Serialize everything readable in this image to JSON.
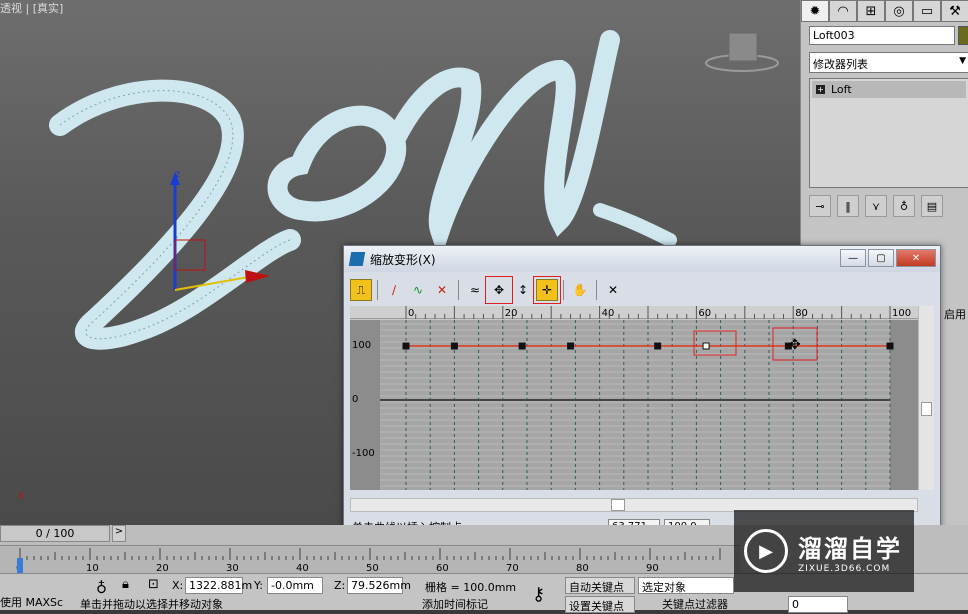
{
  "viewport": {
    "label": "透视 | [真实]",
    "axes": {
      "z": "z",
      "x": "x"
    }
  },
  "command_panel": {
    "tab_icons": [
      "create-icon",
      "modify-icon",
      "hierarchy-icon",
      "motion-icon",
      "display-icon",
      "utilities-icon"
    ],
    "object_name": "Loft003",
    "modifier_list": "修改器列表",
    "stack_item": "Loft",
    "side_text": "启用",
    "object_color": "#6b6b1e"
  },
  "dialog": {
    "title": "缩放变形(X)",
    "win_buttons": {
      "minimize": "—",
      "maximize": "▢",
      "close": "✕"
    },
    "toolbar_icons": [
      "make-symmetrical-icon",
      "display-x-icon",
      "display-y-icon",
      "display-xy-icon",
      "swap-curves-icon",
      "move-control-point-icon",
      "scale-control-point-icon",
      "insert-corner-point-icon",
      "delete-control-point-icon",
      "reset-curve-icon"
    ],
    "ruler_ticks": [
      "0",
      "20",
      "40",
      "60",
      "80",
      "100"
    ],
    "y_labels": [
      "100",
      "0",
      "-100"
    ],
    "curve": {
      "value": 100,
      "control_points_x": [
        0,
        10,
        24,
        34,
        52,
        62,
        79,
        100
      ]
    },
    "status_message": "单击曲线以插入控制点。",
    "coord_x": "63.771",
    "coord_y": "100.0",
    "curve_color": "#e03a1e"
  },
  "timeline": {
    "frame_display": "0 / 100",
    "next_arrow": ">",
    "ticks": [
      "0",
      "10",
      "20",
      "30",
      "40",
      "50",
      "60",
      "70",
      "80",
      "90"
    ]
  },
  "bottom": {
    "x_label": "X:",
    "x_value": "1322.881m",
    "y_label": "Y:",
    "y_value": "-0.0mm",
    "z_label": "Z:",
    "z_value": "79.526mm",
    "grid": "栅格 = 100.0mm",
    "auto_key": "自动关键点",
    "selected": "选定对象",
    "set_key": "设置关键点",
    "key_filter": "关键点过滤器",
    "status_left": "使用 MAXSc",
    "prompt": "单击并拖动以选择并移动对象",
    "add_time_tag": "添加时间标记",
    "frame_field": "0"
  },
  "watermark": {
    "title": "溜溜自学",
    "url": "ZIXUE.3D66.COM"
  }
}
